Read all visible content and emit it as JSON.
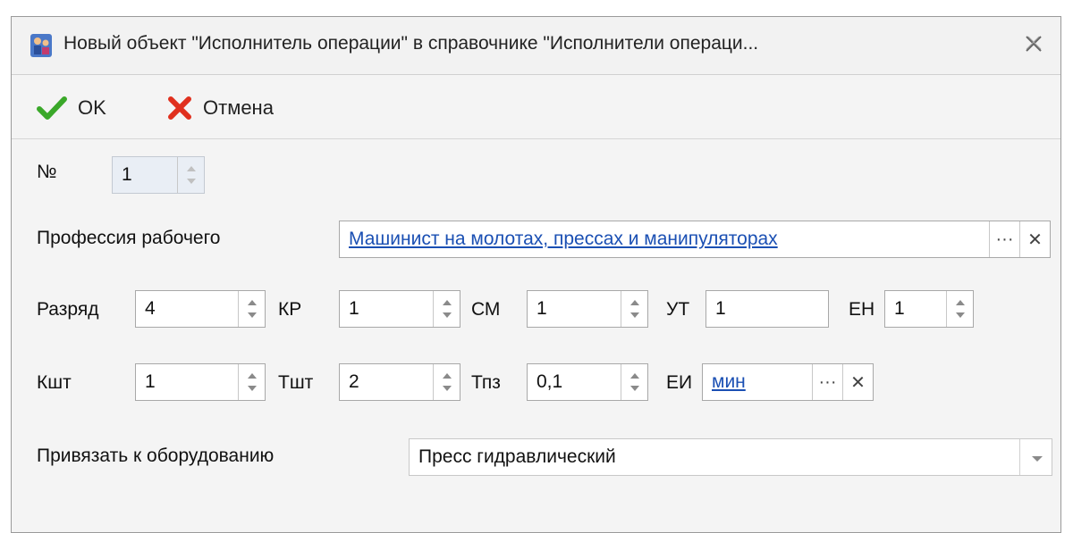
{
  "window": {
    "title": "Новый объект \"Исполнитель операции\" в справочнике \"Исполнители операци...",
    "close_glyph": "✕"
  },
  "toolbar": {
    "ok_label": "OK",
    "cancel_label": "Отмена"
  },
  "form": {
    "number": {
      "label": "№",
      "value": "1"
    },
    "profession": {
      "label": "Профессия рабочего",
      "value": "Машинист на молотах, прессах и манипуляторах",
      "browse": "···",
      "clear": "✕"
    },
    "razryad": {
      "label": "Разряд",
      "value": "4"
    },
    "kr": {
      "label": "КР",
      "value": "1"
    },
    "sm": {
      "label": "СМ",
      "value": "1"
    },
    "ut": {
      "label": "УТ",
      "value": "1"
    },
    "en": {
      "label": "ЕН",
      "value": "1"
    },
    "ksht": {
      "label": "Кшт",
      "value": "1"
    },
    "tsht": {
      "label": "Тшт",
      "value": "2"
    },
    "tpz": {
      "label": "Тпз",
      "value": "0,1"
    },
    "ei": {
      "label": "ЕИ",
      "value": "мин",
      "browse": "···",
      "clear": "✕"
    },
    "equipment": {
      "label": "Привязать к оборудованию",
      "value": "Пресс гидравлический"
    }
  },
  "colors": {
    "link": "#1a4fb3",
    "ok_check": "#3aa829",
    "cancel_x": "#e0301e"
  }
}
